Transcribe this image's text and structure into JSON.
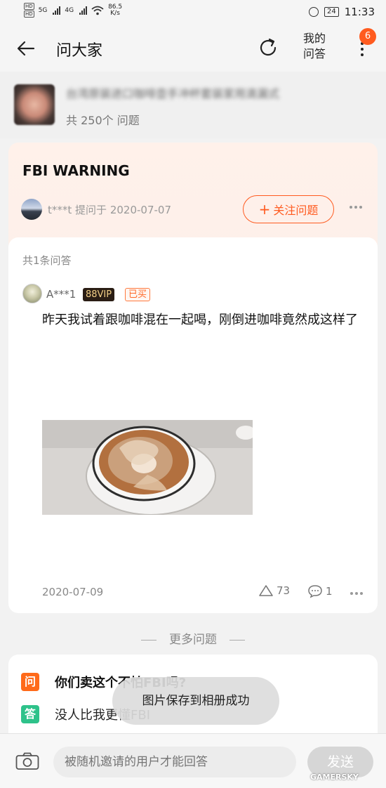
{
  "status_bar": {
    "network_speed": "86.5",
    "network_unit": "K/s",
    "battery": "24",
    "time": "11:33",
    "hd1": "HD",
    "hd2": "HD",
    "sim1": "5G",
    "sim2": "4G"
  },
  "header": {
    "title": "问大家",
    "my_qa_line1": "我的",
    "my_qa_line2": "问答",
    "badge_count": "6"
  },
  "product": {
    "name_blurred": "台湾原装进口咖啡壶手冲杯套装家用滴漏式",
    "question_count": "共 250个 问题"
  },
  "question": {
    "title": "FBI WARNING",
    "asker": "t***t",
    "asked_label": "提问于",
    "asked_date": "2020-07-07",
    "follow_button": "关注问题",
    "follow_plus": "+"
  },
  "answers": {
    "count_label": "共1条问答",
    "items": [
      {
        "user": "A***1",
        "vip_badge": "88VIP",
        "bought_badge": "已买",
        "text": "昨天我试着跟咖啡混在一起喝，刚倒进咖啡竟然成这样了",
        "date": "2020-07-09",
        "likes": "73",
        "comments": "1"
      }
    ]
  },
  "more_questions": {
    "title": "更多问题",
    "q_tag": "问",
    "a_tag": "答",
    "question": "你们卖这个不怕FBI吗?",
    "answer": "没人比我更懂FBI"
  },
  "toast": {
    "message": "图片保存到相册成功"
  },
  "bottom_bar": {
    "input_placeholder": "被随机邀请的用户才能回答",
    "send_button": "发送"
  },
  "watermark": "GAMERSKY",
  "colors": {
    "accent": "#ff5a1f",
    "answer_tag": "#2ec28a",
    "vip_bg": "#2a1d14",
    "vip_text": "#f3cf86"
  }
}
